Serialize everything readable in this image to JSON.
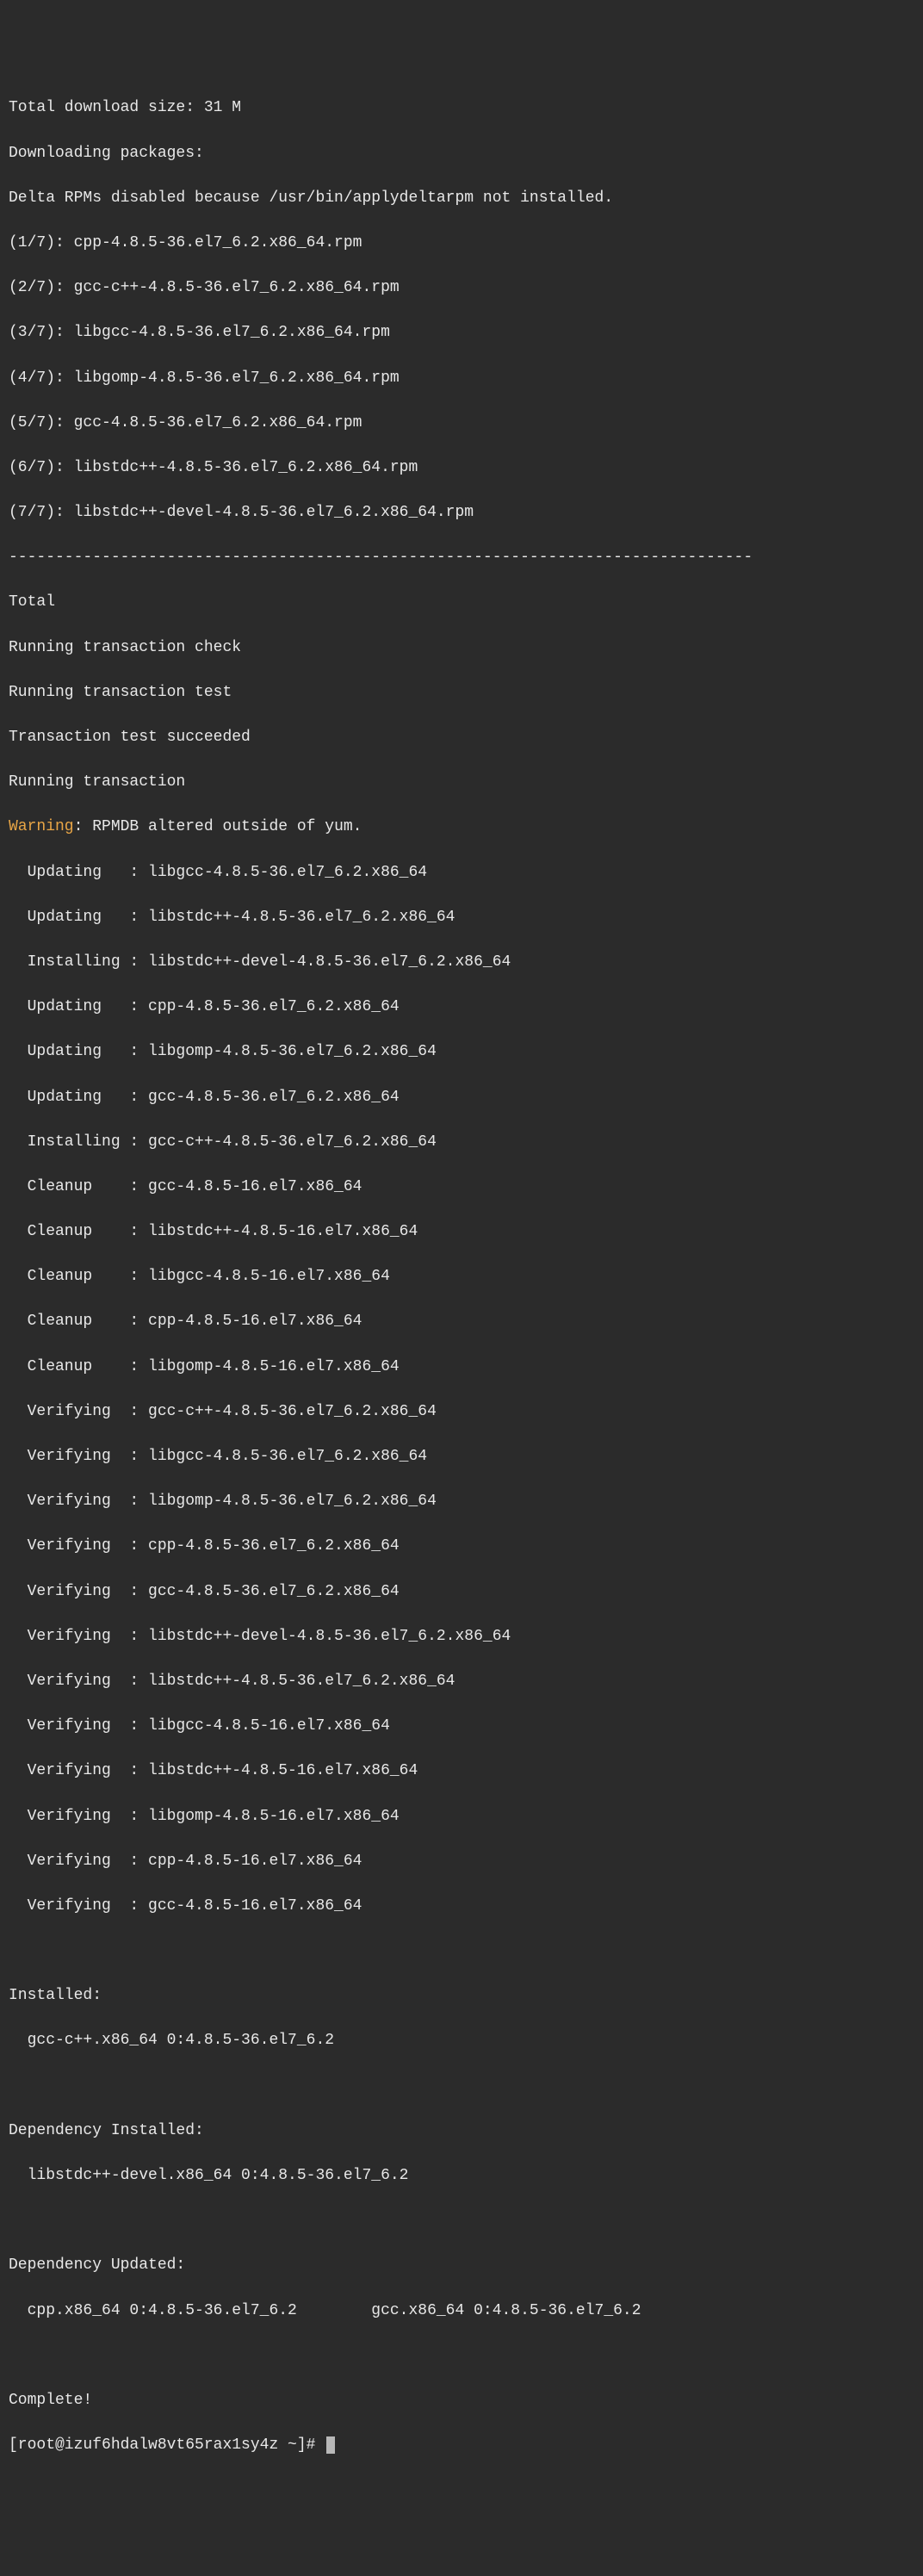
{
  "header": {
    "total_size": "Total download size: 31 M",
    "downloading": "Downloading packages:",
    "delta_disabled": "Delta RPMs disabled because /usr/bin/applydeltarpm not installed."
  },
  "downloads": [
    "(1/7): cpp-4.8.5-36.el7_6.2.x86_64.rpm",
    "(2/7): gcc-c++-4.8.5-36.el7_6.2.x86_64.rpm",
    "(3/7): libgcc-4.8.5-36.el7_6.2.x86_64.rpm",
    "(4/7): libgomp-4.8.5-36.el7_6.2.x86_64.rpm",
    "(5/7): gcc-4.8.5-36.el7_6.2.x86_64.rpm",
    "(6/7): libstdc++-4.8.5-36.el7_6.2.x86_64.rpm",
    "(7/7): libstdc++-devel-4.8.5-36.el7_6.2.x86_64.rpm"
  ],
  "separator": "--------------------------------------------------------------------------------",
  "post_download": {
    "total": "Total",
    "check": "Running transaction check",
    "test": "Running transaction test",
    "test_ok": "Transaction test succeeded",
    "running": "Running transaction"
  },
  "warning": {
    "label": "Warning",
    "text": ": RPMDB altered outside of yum."
  },
  "transactions": [
    "  Updating   : libgcc-4.8.5-36.el7_6.2.x86_64",
    "  Updating   : libstdc++-4.8.5-36.el7_6.2.x86_64",
    "  Installing : libstdc++-devel-4.8.5-36.el7_6.2.x86_64",
    "  Updating   : cpp-4.8.5-36.el7_6.2.x86_64",
    "  Updating   : libgomp-4.8.5-36.el7_6.2.x86_64",
    "  Updating   : gcc-4.8.5-36.el7_6.2.x86_64",
    "  Installing : gcc-c++-4.8.5-36.el7_6.2.x86_64",
    "  Cleanup    : gcc-4.8.5-16.el7.x86_64",
    "  Cleanup    : libstdc++-4.8.5-16.el7.x86_64",
    "  Cleanup    : libgcc-4.8.5-16.el7.x86_64",
    "  Cleanup    : cpp-4.8.5-16.el7.x86_64",
    "  Cleanup    : libgomp-4.8.5-16.el7.x86_64",
    "  Verifying  : gcc-c++-4.8.5-36.el7_6.2.x86_64",
    "  Verifying  : libgcc-4.8.5-36.el7_6.2.x86_64",
    "  Verifying  : libgomp-4.8.5-36.el7_6.2.x86_64",
    "  Verifying  : cpp-4.8.5-36.el7_6.2.x86_64",
    "  Verifying  : gcc-4.8.5-36.el7_6.2.x86_64",
    "  Verifying  : libstdc++-devel-4.8.5-36.el7_6.2.x86_64",
    "  Verifying  : libstdc++-4.8.5-36.el7_6.2.x86_64",
    "  Verifying  : libgcc-4.8.5-16.el7.x86_64",
    "  Verifying  : libstdc++-4.8.5-16.el7.x86_64",
    "  Verifying  : libgomp-4.8.5-16.el7.x86_64",
    "  Verifying  : cpp-4.8.5-16.el7.x86_64",
    "  Verifying  : gcc-4.8.5-16.el7.x86_64"
  ],
  "summary": {
    "installed_header": "Installed:",
    "installed_item": "  gcc-c++.x86_64 0:4.8.5-36.el7_6.2",
    "dep_installed_header": "Dependency Installed:",
    "dep_installed_item": "  libstdc++-devel.x86_64 0:4.8.5-36.el7_6.2",
    "dep_updated_header": "Dependency Updated:",
    "dep_updated_items": "  cpp.x86_64 0:4.8.5-36.el7_6.2        gcc.x86_64 0:4.8.5-36.el7_6.2",
    "complete": "Complete!"
  },
  "prompt": "[root@izuf6hdalw8vt65rax1sy4z ~]# "
}
